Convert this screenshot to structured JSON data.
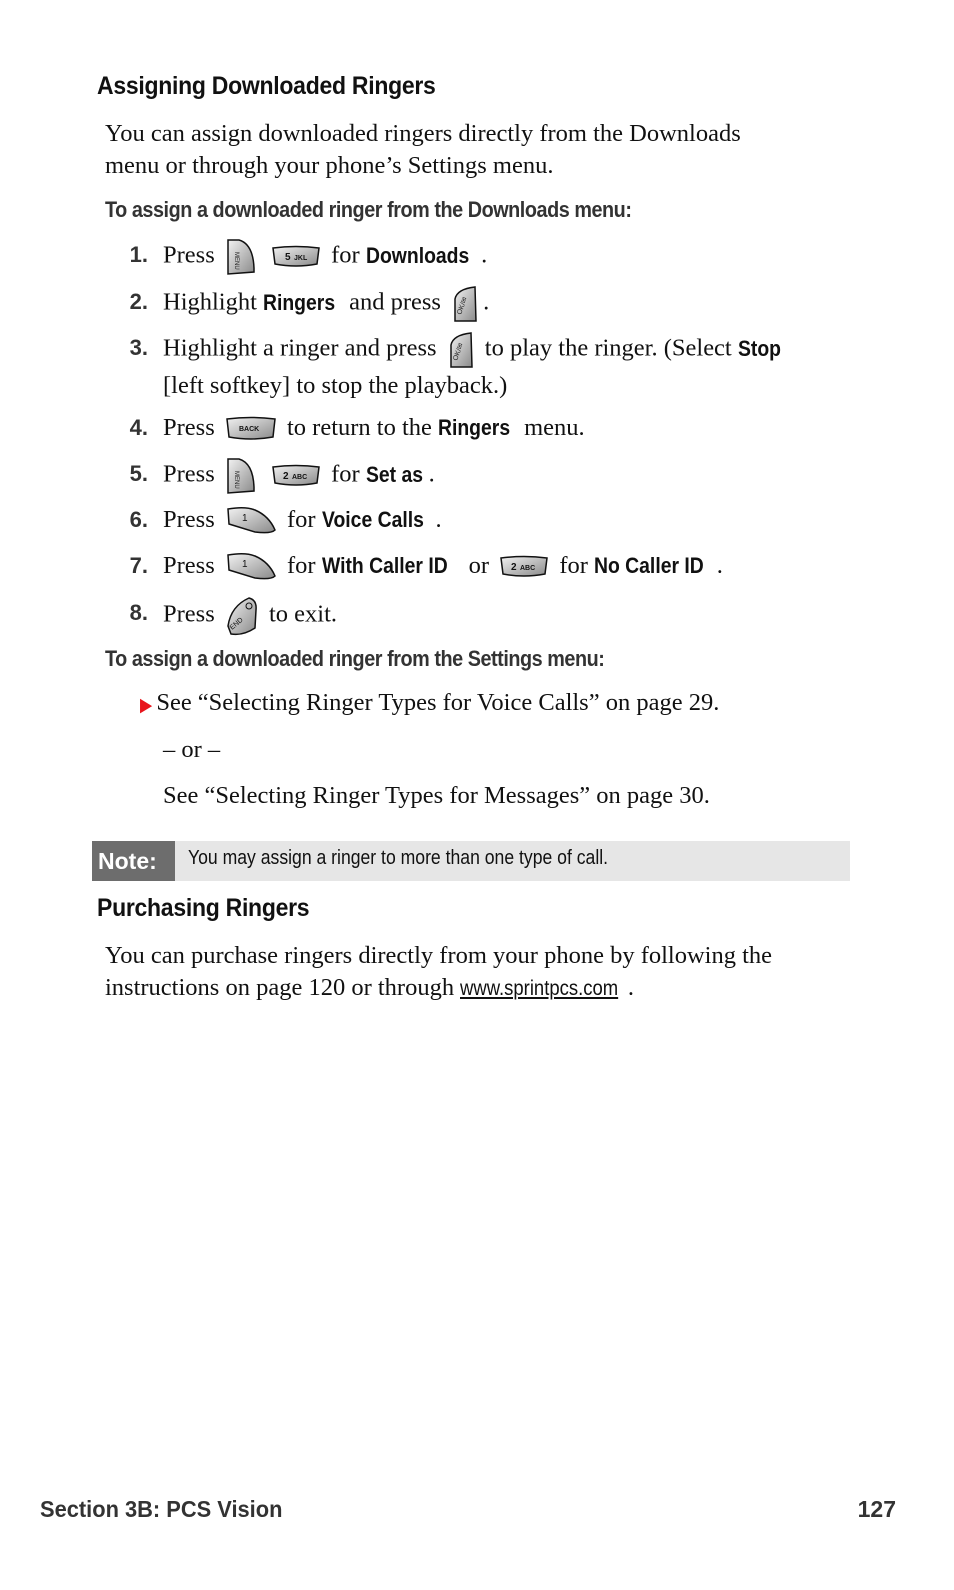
{
  "section1": {
    "heading": "Assigning Downloaded Ringers",
    "intro_line1": "You can assign downloaded ringers directly from the Downloads",
    "intro_line2": "menu or through your phone’s Settings menu.",
    "subheading_downloads": "To assign a downloaded ringer from the Downloads menu:",
    "steps": [
      {
        "num": "1.",
        "t1": "Press",
        "keys": [
          "MENU",
          "5 JKL"
        ],
        "t2": "for",
        "bold": "Downloads",
        "t3": "."
      },
      {
        "num": "2.",
        "t1": "Highlight",
        "bold1": "Ringers",
        "t2": "and press",
        "keys": [
          "OK/✉"
        ],
        "t3": "."
      },
      {
        "num": "3.",
        "t1": "Highlight a ringer and press",
        "keys": [
          "OK/✉"
        ],
        "t2": "to play the ringer. (Select",
        "bold": "Stop",
        "line2": "[left softkey] to stop the playback.)"
      },
      {
        "num": "4.",
        "t1": "Press",
        "keys": [
          "BACK"
        ],
        "t2": "to return to the",
        "bold": "Ringers",
        "t3": "menu."
      },
      {
        "num": "5.",
        "t1": "Press",
        "keys": [
          "MENU",
          "2 ABC"
        ],
        "t2": "for",
        "bold": "Set as",
        "t3": "."
      },
      {
        "num": "6.",
        "t1": "Press",
        "keys": [
          "1"
        ],
        "t2": "for",
        "bold": "Voice Calls",
        "t3": "."
      },
      {
        "num": "7.",
        "t1": "Press",
        "keys": [
          "1",
          "2 ABC"
        ],
        "t2": "for",
        "bold1": "With Caller ID",
        "t3": "or",
        "t4": "for",
        "bold2": "No Caller ID",
        "t5": "."
      },
      {
        "num": "8.",
        "t1": "Press",
        "keys": [
          "END"
        ],
        "t2": "to exit."
      }
    ],
    "subheading_settings": "To assign a downloaded ringer from the Settings menu:",
    "bullet1": "See “Selecting Ringer Types for Voice Calls” on page 29.",
    "or_text": "– or –",
    "bullet2": "See “Selecting Ringer Types for Messages” on page 30."
  },
  "note": {
    "label": "Note:",
    "text": "You may assign a ringer to more than one type of call."
  },
  "section2": {
    "heading": "Purchasing Ringers",
    "line1": "You can purchase ringers directly from your phone by following the",
    "line2_text": "instructions on page 120 or through",
    "link": "www.sprintpcs.com",
    "line2_end": "."
  },
  "footer": {
    "section": "Section 3B: PCS Vision",
    "page": "127"
  },
  "colors": {
    "bullet_arrow": "#e8141b",
    "note_label_bg": "#6d6d6d",
    "note_bg": "#e6e6e6"
  }
}
